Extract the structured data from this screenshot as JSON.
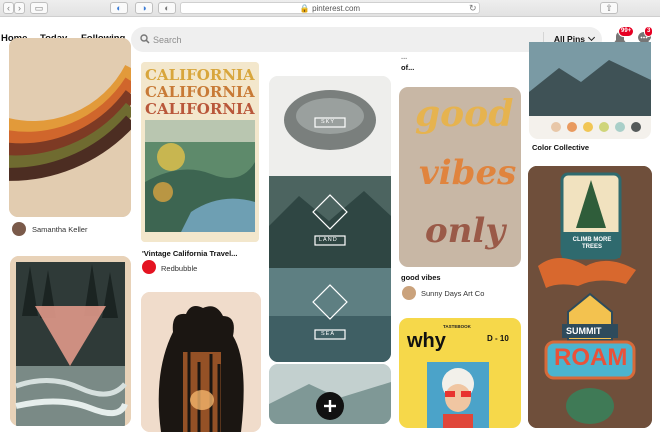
{
  "browser": {
    "url": "pinterest.com"
  },
  "nav": {
    "home": "Home",
    "today": "Today",
    "following": "Following"
  },
  "search": {
    "placeholder": "Search",
    "value": "",
    "filter": "All Pins"
  },
  "header": {
    "notifications_badge": "99+",
    "messages_badge": "3"
  },
  "pins": [
    {
      "id": "retro-stripes",
      "user": "Samantha Keller"
    },
    {
      "id": "vintage-california",
      "image_text": [
        "CALIFORNIA",
        "CALIFORNIA",
        "CALIFORNIA"
      ],
      "title": "'Vintage California Travel...",
      "user": "Redbubble"
    },
    {
      "id": "sky-land-sea",
      "image_text": [
        "SKY",
        "LAND",
        "SEA"
      ]
    },
    {
      "id": "top-cut",
      "title": "...",
      "title2": "of..."
    },
    {
      "id": "good-vibes",
      "image_text": [
        "good",
        "vibes",
        "only"
      ],
      "title": "good vibes",
      "user": "Sunny Days Art Co"
    },
    {
      "id": "color-collective",
      "title": "Color Collective",
      "swatches": [
        "#e8c7a8",
        "#e99a5f",
        "#f1c655",
        "#cfd57a",
        "#a9cfc9",
        "#555a5a"
      ]
    },
    {
      "id": "magazine",
      "image_text": [
        "why",
        "D - 10",
        "TASTEBOOK"
      ]
    },
    {
      "id": "patches",
      "image_text": [
        "CLIMB MORE TREES",
        "SUMMIT",
        "ROAM"
      ]
    }
  ],
  "colors": {
    "brand": "#e60023",
    "text": "#111111"
  }
}
